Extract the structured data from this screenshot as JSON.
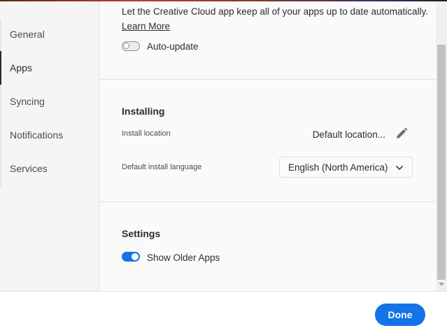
{
  "sidebar": {
    "items": [
      {
        "label": "General",
        "active": false
      },
      {
        "label": "Apps",
        "active": true
      },
      {
        "label": "Syncing",
        "active": false
      },
      {
        "label": "Notifications",
        "active": false
      },
      {
        "label": "Services",
        "active": false
      }
    ]
  },
  "auto_update": {
    "description": "Let the Creative Cloud app keep all of your apps up to date automatically.",
    "learn_more": "Learn More",
    "toggle_label": "Auto-update",
    "enabled": false
  },
  "installing": {
    "heading": "Installing",
    "install_location_label": "Install location",
    "install_location_value": "Default location...",
    "language_label": "Default install language",
    "language_value": "English (North America)"
  },
  "settings": {
    "heading": "Settings",
    "show_older_apps_label": "Show Older Apps",
    "show_older_apps_enabled": true
  },
  "footer": {
    "done_label": "Done"
  },
  "colors": {
    "accent": "#1473e6"
  }
}
